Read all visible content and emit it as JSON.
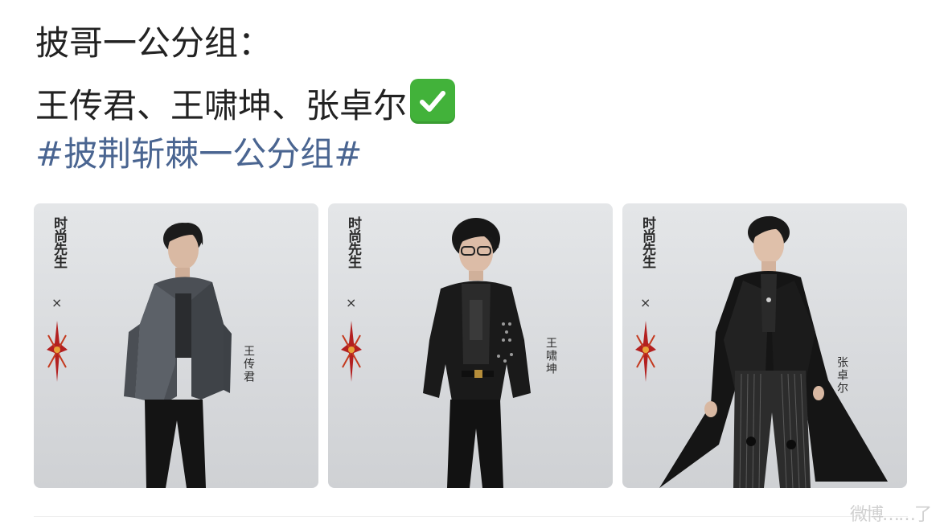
{
  "post": {
    "line1": "披哥一公分组：",
    "line2": "王传君、王啸坤、张卓尔",
    "emoji": "check-mark-button-icon",
    "hashtag": "#披荆斩棘一公分组#"
  },
  "photos": [
    {
      "logo": "时尚先生",
      "cross": "×",
      "name": "王传君"
    },
    {
      "logo": "时尚先生",
      "cross": "×",
      "name": "王啸坤"
    },
    {
      "logo": "时尚先生",
      "cross": "×",
      "name": "张卓尔"
    }
  ],
  "footer": {
    "watermark": "微博……了"
  },
  "colors": {
    "text": "#222222",
    "hashtag": "#4a6591",
    "check": "#42b23a",
    "photo_bg": "#dadcdf"
  }
}
